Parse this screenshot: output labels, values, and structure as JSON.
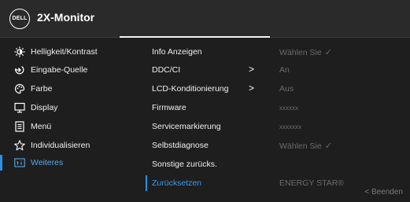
{
  "header": {
    "logo": "DELL",
    "title": "2X-Monitor"
  },
  "sidebar": {
    "items": [
      {
        "label": "Helligkeit/Kontrast",
        "icon": "brightness-icon"
      },
      {
        "label": "Eingabe-Quelle",
        "icon": "input-source-icon"
      },
      {
        "label": "Farbe",
        "icon": "color-palette-icon"
      },
      {
        "label": "Display",
        "icon": "display-icon"
      },
      {
        "label": "Menü",
        "icon": "menu-document-icon"
      },
      {
        "label": "Individualisieren",
        "icon": "star-icon"
      },
      {
        "label": "Weiteres",
        "icon": "others-icon",
        "active": true
      }
    ]
  },
  "menu": {
    "items": [
      {
        "label": "Info Anzeigen",
        "value": "Wählen Sie",
        "value_check": "✓"
      },
      {
        "label": "DDC/CI",
        "chevron": ">",
        "value": "An"
      },
      {
        "label": "LCD-Konditionierung",
        "chevron": ">",
        "value": "Aus"
      },
      {
        "label": "Firmware",
        "value": "xxxxxx"
      },
      {
        "label": "Servicemarkierung",
        "value": "xxxxxxx"
      },
      {
        "label": "Selbstdiagnose",
        "value": "Wählen Sie",
        "value_check": "✓"
      },
      {
        "label": "Sonstige zurücks.",
        "value": ""
      },
      {
        "label": "Zurücksetzen",
        "value": "ENERGY STAR®",
        "selected": true
      }
    ]
  },
  "footer": {
    "exit": "< Beenden"
  },
  "colors": {
    "accent": "#2f8fe0",
    "background": "#1e1e1f",
    "header": "#2a2a2b",
    "disabled_text": "#6b6b6c"
  }
}
